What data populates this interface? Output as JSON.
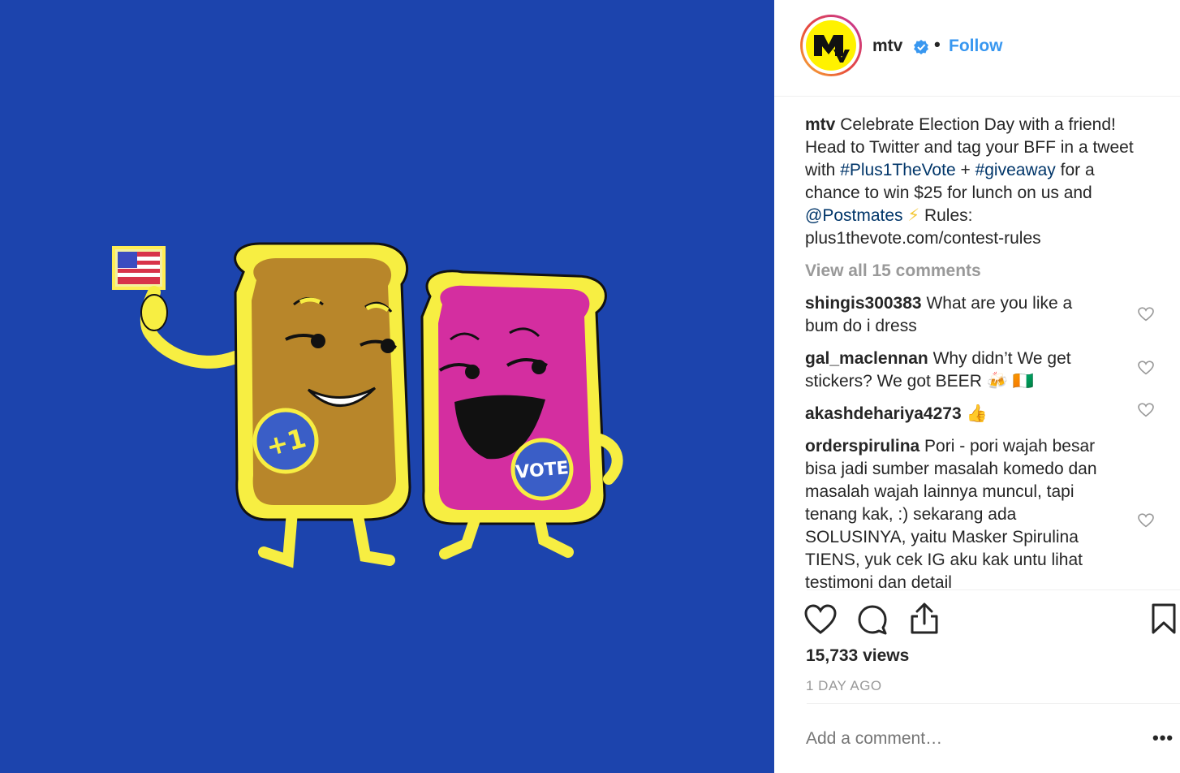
{
  "post": {
    "username": "mtv",
    "follow_label": "Follow",
    "separator": "•",
    "caption": {
      "text1": "Celebrate Election Day with a friend! Head to Twitter and tag your BFF in a tweet with ",
      "hashtag1": "#Plus1TheVote",
      "plus": " + ",
      "hashtag2": "#giveaway",
      "text2": " for a chance to win $25 for lunch on us and ",
      "mention": "@Postmates",
      "emoji": "⚡",
      "text3": " Rules: plus1thevote.com/contest-rules"
    },
    "view_all_label": "View all 15 comments",
    "comments": [
      {
        "user": "shingis300383",
        "text": "What are you like a bum do i dress"
      },
      {
        "user": "gal_maclennan",
        "text": "Why didn’t We get stickers? We got BEER 🍻 🇨🇮"
      },
      {
        "user": "akashdehariya4273",
        "text": "👍"
      },
      {
        "user": "orderspirulina",
        "text": "Pori - pori wajah besar bisa jadi sumber masalah komedo dan masalah wajah lainnya muncul, tapi tenang kak, :) sekarang ada SOLUSINYA, yaitu Masker Spirulina TIENS, yuk cek IG aku kak untu lihat testimoni dan detail"
      }
    ],
    "views": "15,733 views",
    "time_ago": "1 DAY AGO",
    "add_comment_placeholder": "Add a comment…",
    "more_label": "•••"
  },
  "media": {
    "badge_left": "+1",
    "badge_right": "VOTE"
  },
  "colors": {
    "media_bg": "#1c44ad",
    "link": "#3897f0",
    "hashtag": "#003569",
    "bread_crust": "#f7ee42",
    "peanut_butter": "#b8862a",
    "jelly": "#d42ea0"
  },
  "icons": [
    "mtv-logo-icon",
    "verified-badge-icon",
    "like-icon",
    "comment-icon",
    "share-icon",
    "bookmark-icon",
    "heart-outline-icon"
  ]
}
